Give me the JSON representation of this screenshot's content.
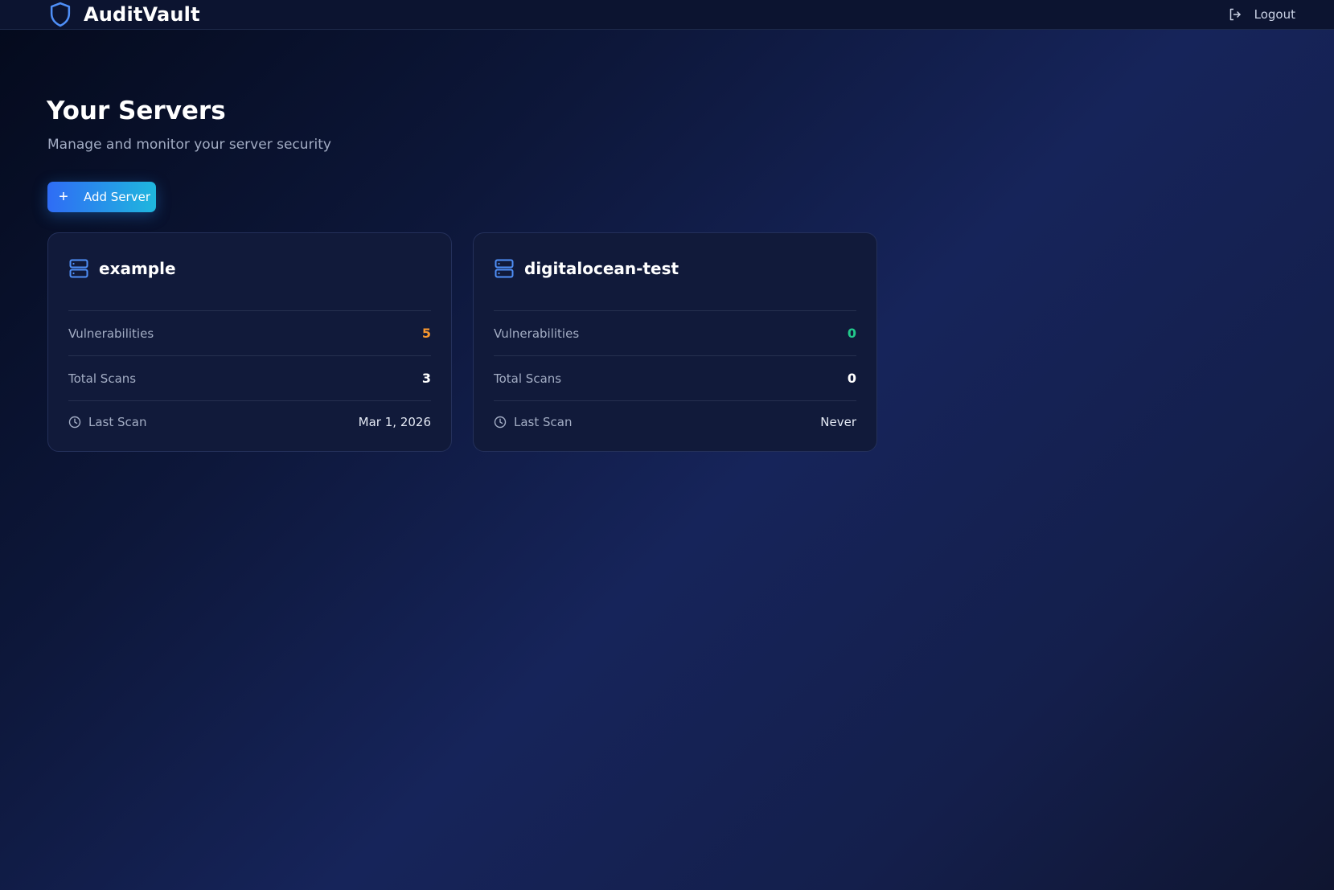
{
  "app": {
    "name": "AuditVault",
    "logout_label": "Logout"
  },
  "page": {
    "title": "Your Servers",
    "subtitle": "Manage and monitor your server security",
    "add_button_label": "Add Server"
  },
  "labels": {
    "vulnerabilities": "Vulnerabilities",
    "total_scans": "Total Scans",
    "last_scan": "Last Scan"
  },
  "servers": [
    {
      "name": "example",
      "vulnerabilities": "5",
      "total_scans": "3",
      "last_scan": "Mar 1, 2026"
    },
    {
      "name": "digitalocean-test",
      "vulnerabilities": "0",
      "total_scans": "0",
      "last_scan": "Never"
    }
  ],
  "colors": {
    "accent": "#4f8ff7",
    "vuln_warning": "#f5962f",
    "vuln_ok": "#22c98b"
  },
  "icons": {
    "brand": "shield-icon",
    "logout": "logout-icon",
    "add": "plus-icon",
    "server": "server-icon",
    "last_scan": "clock-icon"
  }
}
